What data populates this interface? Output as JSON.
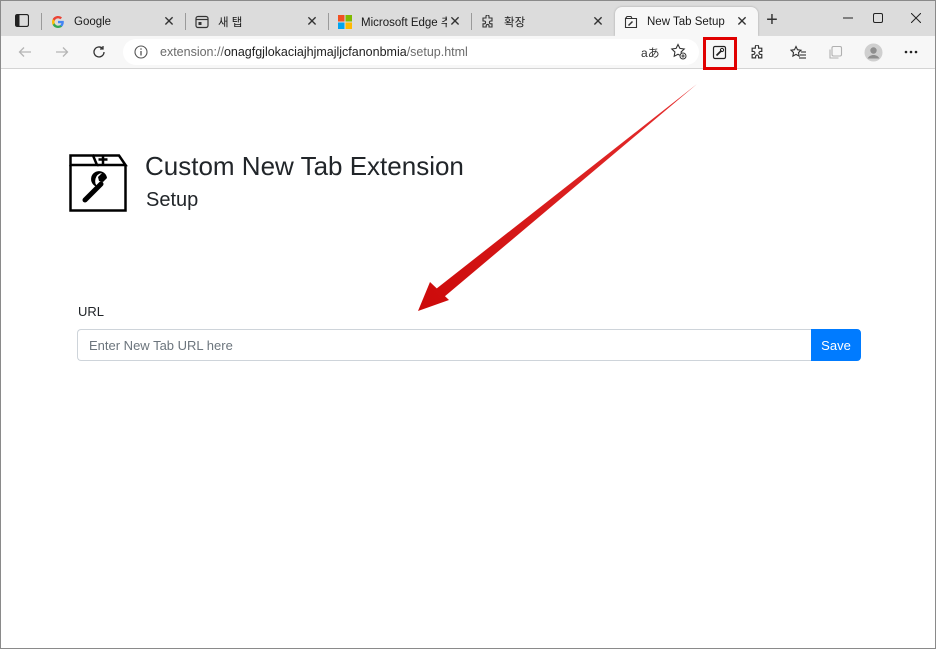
{
  "tabs": [
    {
      "title": "Google",
      "favicon": "google-g-icon"
    },
    {
      "title": "새 탭",
      "favicon": "new-tab-icon"
    },
    {
      "title": "Microsoft Edge 추가",
      "favicon": "microsoft-logo-icon"
    },
    {
      "title": "확장",
      "favicon": "puzzle-icon"
    },
    {
      "title": "New Tab Setup",
      "favicon": "extension-icon",
      "active": true
    }
  ],
  "address_bar": {
    "url_prefix": "extension://",
    "url_host": "onagfgjlokaciajhjmajljcfanonbmia",
    "url_path": "/setup.html",
    "read_aloud": "aあ"
  },
  "page": {
    "title": "Custom New Tab Extension",
    "subtitle": "Setup",
    "url_label": "URL",
    "url_placeholder": "Enter New Tab URL here",
    "save_label": "Save"
  },
  "colors": {
    "accent": "#007bff",
    "highlight": "#e00000",
    "arrow": "#e31e1e"
  }
}
